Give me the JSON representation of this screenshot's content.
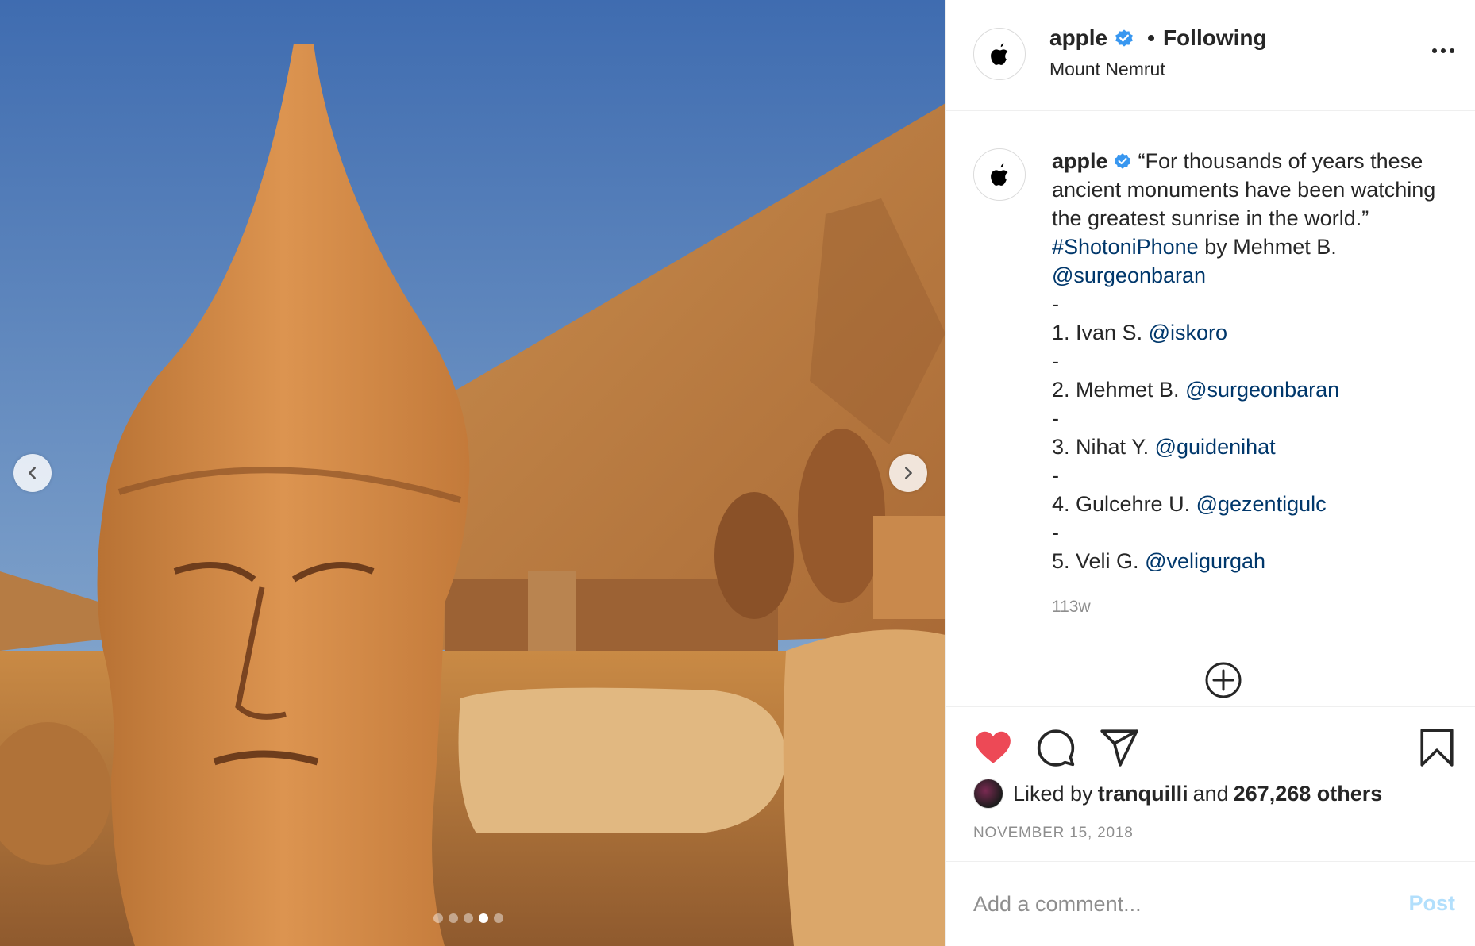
{
  "post": {
    "username": "apple",
    "follow_status": "Following",
    "separator": "•",
    "location": "Mount Nemrut",
    "caption": {
      "username": "apple",
      "text_1": "“For thousands of years these ancient monuments have been watching the greatest sunrise in the world.”",
      "hashtag": "#ShotoniPhone",
      "text_2": "by Mehmet B.",
      "mention_main": "@surgeonbaran",
      "dash": "-",
      "credits": [
        {
          "text": "1. Ivan S.",
          "handle": "@iskoro"
        },
        {
          "text": "2. Mehmet B.",
          "handle": "@surgeonbaran"
        },
        {
          "text": "3. Nihat Y.",
          "handle": "@guidenihat"
        },
        {
          "text": "4. Gulcehre U.",
          "handle": "@gezentigulc"
        },
        {
          "text": "5. Veli G.",
          "handle": "@veligurgah"
        }
      ]
    },
    "caption_age": "113w",
    "likes": {
      "prefix": "Liked by",
      "user": "tranquilli",
      "connector": "and",
      "others": "267,268 others"
    },
    "date": "NOVEMBER 15, 2018",
    "comment": {
      "placeholder": "Add a comment...",
      "post_label": "Post"
    },
    "carousel": {
      "total": 5,
      "active_index": 3
    }
  },
  "icons": {
    "header_avatar": "apple-logo-icon",
    "verified": "verified-badge-icon",
    "more": "more-options-icon",
    "load_more": "plus-circle-icon",
    "like": "heart-icon",
    "comment": "comment-icon",
    "share": "share-icon",
    "save": "bookmark-icon",
    "prev": "chevron-left-icon",
    "next": "chevron-right-icon"
  },
  "colors": {
    "link": "#00376b",
    "verified": "#3897f0",
    "like": "#ed4956",
    "post_disabled": "#b2dffc",
    "muted": "#8e8e8e"
  }
}
